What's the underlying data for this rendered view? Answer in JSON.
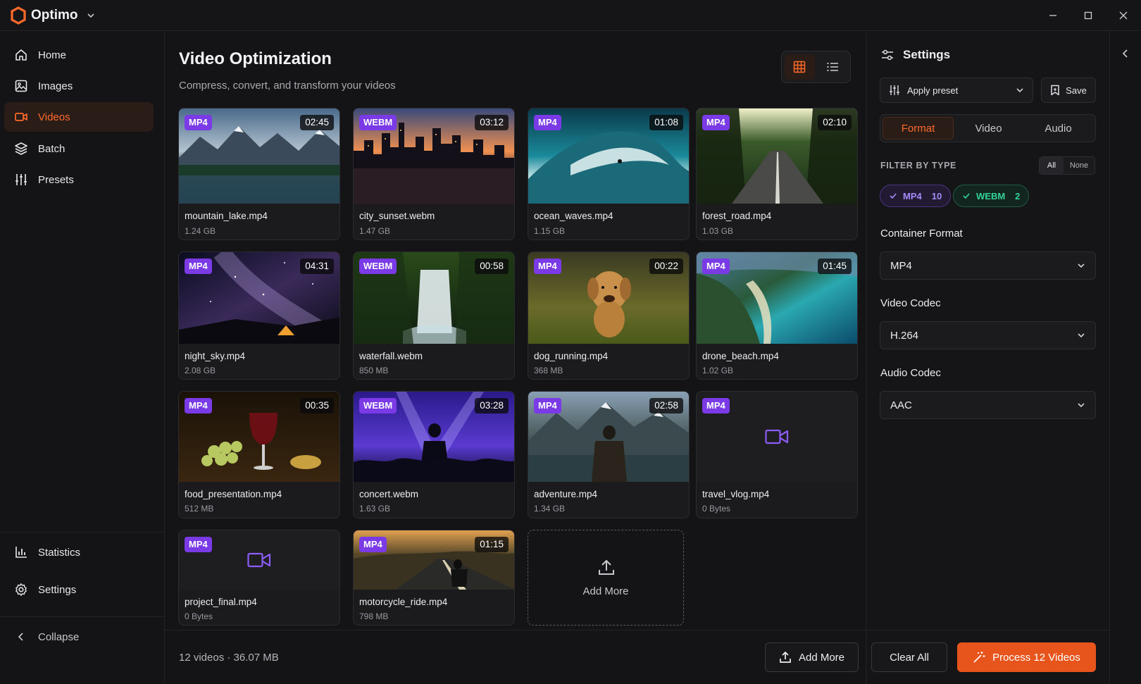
{
  "app": {
    "name": "Optimo"
  },
  "sidebar": {
    "items": [
      {
        "label": "Home",
        "icon": "home-icon"
      },
      {
        "label": "Images",
        "icon": "image-icon"
      },
      {
        "label": "Videos",
        "icon": "video-icon",
        "active": true
      },
      {
        "label": "Batch",
        "icon": "layers-icon"
      },
      {
        "label": "Presets",
        "icon": "sliders-icon"
      }
    ],
    "statistics": "Statistics",
    "settings": "Settings",
    "collapse": "Collapse"
  },
  "main": {
    "title": "Video Optimization",
    "subtitle": "Compress, convert, and transform your videos",
    "videos": [
      {
        "format": "MP4",
        "duration": "02:45",
        "name": "mountain_lake.mp4",
        "size": "1.24 GB"
      },
      {
        "format": "WEBM",
        "duration": "03:12",
        "name": "city_sunset.webm",
        "size": "1.47 GB"
      },
      {
        "format": "MP4",
        "duration": "01:08",
        "name": "ocean_waves.mp4",
        "size": "1.15 GB"
      },
      {
        "format": "MP4",
        "duration": "02:10",
        "name": "forest_road.mp4",
        "size": "1.03 GB"
      },
      {
        "format": "MP4",
        "duration": "04:31",
        "name": "night_sky.mp4",
        "size": "2.08 GB"
      },
      {
        "format": "WEBM",
        "duration": "00:58",
        "name": "waterfall.webm",
        "size": "850 MB"
      },
      {
        "format": "MP4",
        "duration": "00:22",
        "name": "dog_running.mp4",
        "size": "368 MB"
      },
      {
        "format": "MP4",
        "duration": "01:45",
        "name": "drone_beach.mp4",
        "size": "1.02 GB"
      },
      {
        "format": "MP4",
        "duration": "00:35",
        "name": "food_presentation.mp4",
        "size": "512 MB"
      },
      {
        "format": "WEBM",
        "duration": "03:28",
        "name": "concert.webm",
        "size": "1.63 GB"
      },
      {
        "format": "MP4",
        "duration": "02:58",
        "name": "adventure.mp4",
        "size": "1.34 GB"
      },
      {
        "format": "MP4",
        "duration": "",
        "name": "travel_vlog.mp4",
        "size": "0 Bytes"
      },
      {
        "format": "MP4",
        "duration": "",
        "name": "project_final.mp4",
        "size": "0 Bytes"
      },
      {
        "format": "MP4",
        "duration": "01:15",
        "name": "motorcycle_ride.mp4",
        "size": "798 MB"
      }
    ],
    "add_more_card": "Add More",
    "footer": {
      "count_text": "12 videos · 36.07 MB",
      "add_more": "Add More",
      "clear_all": "Clear All",
      "process": "Process 12 Videos"
    }
  },
  "panel": {
    "title": "Settings",
    "apply_preset": "Apply preset",
    "save": "Save",
    "tabs": [
      "Format",
      "Video",
      "Audio"
    ],
    "filter_label": "FILTER BY TYPE",
    "filter_all": "All",
    "filter_none": "None",
    "chips": [
      {
        "label": "MP4",
        "count": "10"
      },
      {
        "label": "WEBM",
        "count": "2"
      }
    ],
    "container_label": "Container Format",
    "container_value": "MP4",
    "video_codec_label": "Video Codec",
    "video_codec_value": "H.264",
    "audio_codec_label": "Audio Codec",
    "audio_codec_value": "AAC"
  },
  "colors": {
    "accent": "#ff6a2b",
    "format_badge": "#7a3be6",
    "mp4_chip": "#a78bfa",
    "webm_chip": "#34d399"
  }
}
